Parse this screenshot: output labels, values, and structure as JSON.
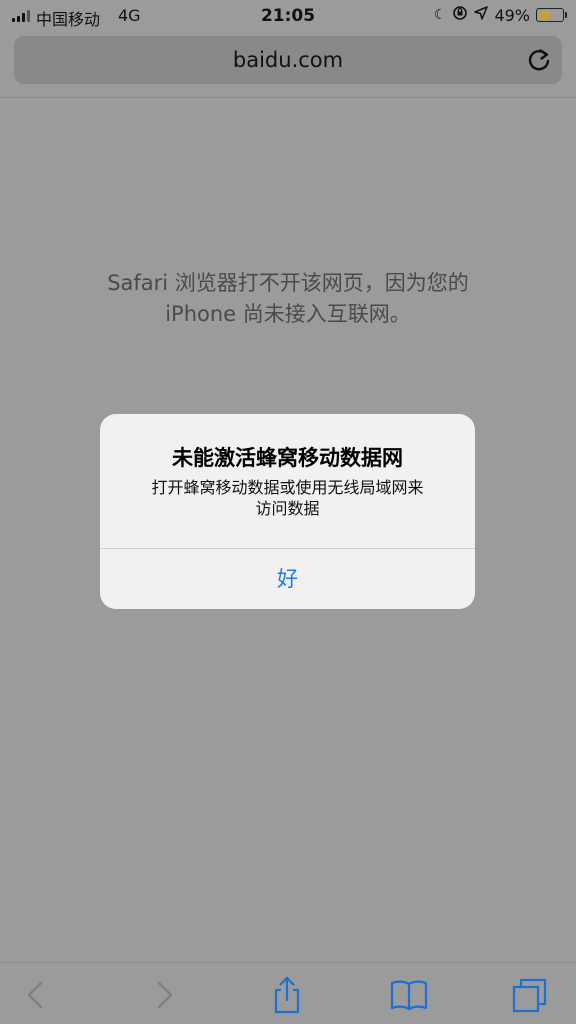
{
  "status_bar": {
    "carrier": "中国移动",
    "network": "4G",
    "time": "21:05",
    "battery_percent": "49%",
    "icons": [
      "signal-icon",
      "moon-icon",
      "orientation-lock-icon",
      "location-icon",
      "battery-icon"
    ]
  },
  "browser": {
    "url": "baidu.com"
  },
  "page": {
    "error_line1": "Safari 浏览器打不开该网页，因为您的",
    "error_line2": "iPhone 尚未接入互联网。"
  },
  "alert": {
    "title": "未能激活蜂窝移动数据网",
    "body_line1": "打开蜂窝移动数据或使用无线局域网来",
    "body_line2": "访问数据",
    "ok_label": "好"
  },
  "toolbar": {
    "icons": [
      "back-icon",
      "forward-icon",
      "share-icon",
      "bookmarks-icon",
      "tabs-icon"
    ]
  },
  "colors": {
    "accent": "#1f7ae0",
    "dim_background": "#9b9b9b"
  }
}
